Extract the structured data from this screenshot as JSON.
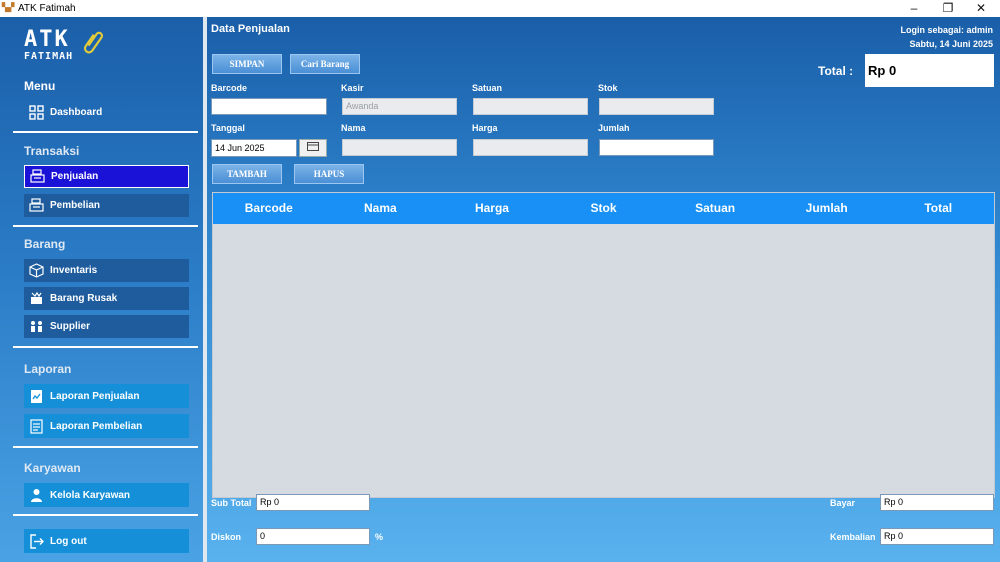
{
  "window": {
    "title": "ATK Fatimah",
    "minimize": "–",
    "maximize": "❐",
    "close": "✕"
  },
  "logo": {
    "line1": "ATK",
    "line2": "FATIMAH"
  },
  "sidebar": {
    "menu_title": "Menu",
    "dashboard": "Dashboard",
    "transaksi_title": "Transaksi",
    "penjualan": "Penjualan",
    "pembelian": "Pembelian",
    "barang_title": "Barang",
    "inventaris": "Inventaris",
    "barang_rusak": "Barang Rusak",
    "supplier": "Supplier",
    "laporan_title": "Laporan",
    "laporan_penjualan": "Laporan Penjualan",
    "laporan_pembelian": "Laporan Pembelian",
    "karyawan_title": "Karyawan",
    "kelola_karyawan": "Kelola Karyawan",
    "logout": "Log out"
  },
  "header": {
    "page_title": "Data Penjualan",
    "login_info": "Login sebagai: admin",
    "date_info": "Sabtu, 14 Juni 2025",
    "total_label": "Total  :",
    "total_value": "Rp 0"
  },
  "buttons": {
    "simpan": "SIMPAN",
    "cari_barang": "Cari Barang",
    "tambah": "TAMBAH",
    "hapus": "HAPUS"
  },
  "form": {
    "barcode_label": "Barcode",
    "barcode_value": "",
    "kasir_label": "Kasir",
    "kasir_value": "Awanda",
    "satuan_label": "Satuan",
    "satuan_value": "",
    "stok_label": "Stok",
    "stok_value": "",
    "tanggal_label": "Tanggal",
    "tanggal_value": "14 Jun 2025",
    "nama_label": "Nama",
    "nama_value": "",
    "harga_label": "Harga",
    "harga_value": "",
    "jumlah_label": "Jumlah",
    "jumlah_value": ""
  },
  "table": {
    "columns": [
      "Barcode",
      "Nama",
      "Harga",
      "Stok",
      "Satuan",
      "Jumlah",
      "Total"
    ],
    "rows": []
  },
  "footer": {
    "subtotal_label": "Sub Total",
    "subtotal_value": "Rp 0",
    "diskon_label": "Diskon",
    "diskon_value": "0",
    "diskon_unit": "%",
    "bayar_label": "Bayar",
    "bayar_value": "Rp 0",
    "kembalian_label": "Kembalian",
    "kembalian_value": "Rp 0"
  }
}
